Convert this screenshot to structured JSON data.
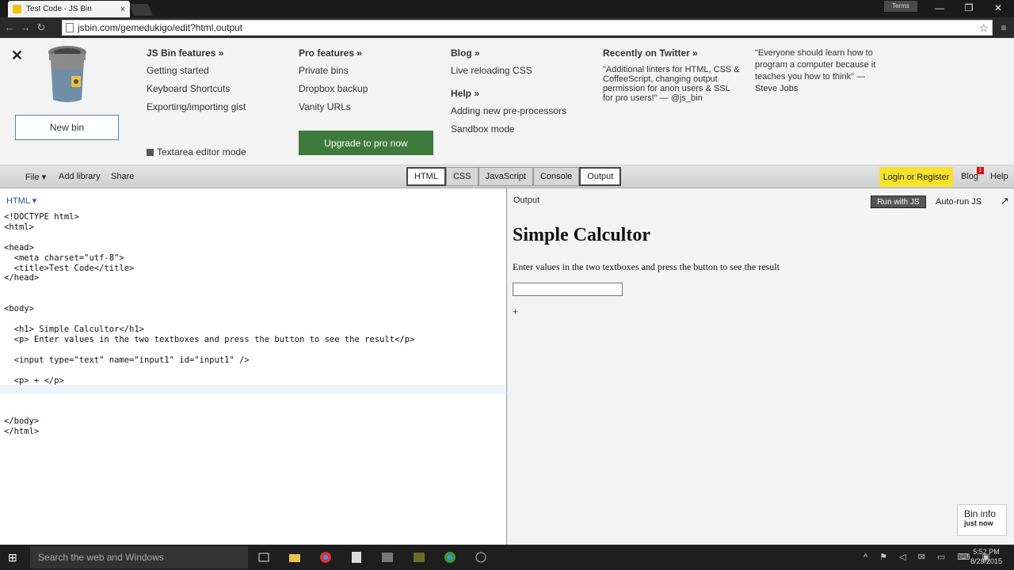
{
  "browser": {
    "tab_title": "Test Code - JS Bin",
    "tab_close": "×",
    "user_label": "Terms",
    "url": "jsbin.com/gemedukigo/edit?html,output",
    "win_min": "—",
    "win_max": "❐",
    "win_close": "✕"
  },
  "panel": {
    "close": "✕",
    "new_bin": "New bin",
    "col1": {
      "heading": "JS Bin features »",
      "links": [
        "Getting started",
        "Keyboard Shortcuts",
        "Exporting/importing gist"
      ]
    },
    "col2": {
      "heading": "Pro features »",
      "links": [
        "Private bins",
        "Dropbox backup",
        "Vanity URLs"
      ]
    },
    "col3": {
      "heading": "Blog »",
      "links": [
        "Live reloading CSS"
      ],
      "heading2": "Help »",
      "links2": [
        "Adding new pre-processors",
        "Sandbox mode"
      ]
    },
    "col4": {
      "heading": "Recently on Twitter »",
      "quote": "\"Additional linters for HTML, CSS & CoffeeScript, changing output permission for anon users & SSL for pro users!\" — @js_bin"
    },
    "col5": {
      "quote": "\"Everyone should learn how to program a computer because it teaches you how to think\" — Steve Jobs"
    },
    "textarea_mode": "Textarea editor mode",
    "upgrade": "Upgrade to pro now"
  },
  "toolbar": {
    "file": "File ▾",
    "add_library": "Add library",
    "share": "Share",
    "tabs": [
      {
        "label": "HTML",
        "active": true
      },
      {
        "label": "CSS",
        "active": false
      },
      {
        "label": "JavaScript",
        "active": false
      },
      {
        "label": "Console",
        "active": false
      },
      {
        "label": "Output",
        "active": true
      }
    ],
    "login": "Login or Register",
    "blog": "Blog",
    "blog_badge": "1",
    "help": "Help"
  },
  "editor": {
    "label": "HTML ▾",
    "code": "<!DOCTYPE html>\n<html>\n\n<head>\n  <meta charset=\"utf-8\">\n  <title>Test Code</title>\n</head>\n\n\n<body>\n\n  <h1> Simple Calcultor</h1>\n  <p> Enter values in the two textboxes and press the button to see the result</p>\n\n  <input type=\"text\" name=\"input1\" id=\"input1\" />\n\n  <p> + </p>\n\n\n\n</body>\n</html>"
  },
  "output": {
    "label": "Output",
    "run_js": "Run with JS",
    "autorun": "Auto-run JS",
    "popout": "↗",
    "h1": "Simple Calcultor",
    "p": "Enter values in the two textboxes and press the button to see the result",
    "plus": "+",
    "bin_info": "Bin info",
    "bin_info_sub": "just now"
  },
  "taskbar": {
    "search": "Search the web and Windows",
    "time": "5:52 PM",
    "date": "8/29/2015"
  },
  "colors": {
    "upgrade_green": "#3f7a3d",
    "login_yellow": "#f7e22a",
    "link_blue": "#2a5c9a"
  }
}
